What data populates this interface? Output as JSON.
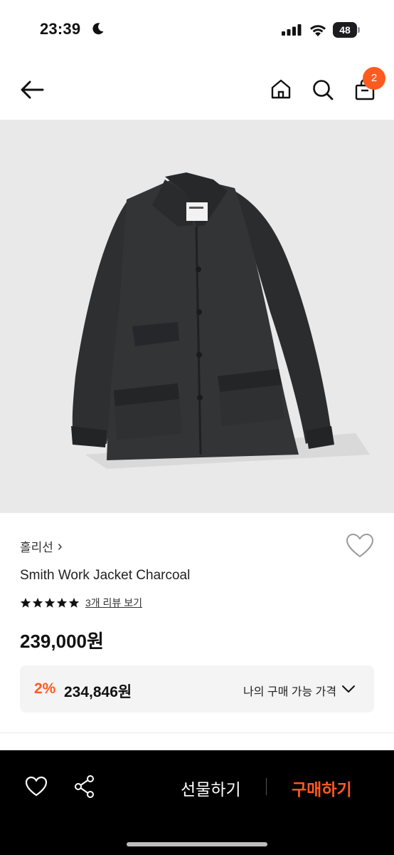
{
  "status_bar": {
    "time": "23:39",
    "battery_level": "48",
    "icons": [
      "moon-icon",
      "signal-icon",
      "wifi-icon",
      "battery-icon"
    ]
  },
  "nav": {
    "icons": [
      "back-arrow-icon",
      "home-icon",
      "search-icon",
      "cart-icon"
    ],
    "cart_count": "2"
  },
  "product": {
    "image": "charcoal-work-jacket-photo",
    "brand": "홀리선",
    "brand_chevron": "›",
    "name": "Smith Work Jacket Charcoal",
    "rating_stars": 5,
    "review_link": "3개 리뷰 보기",
    "price": "239,000원",
    "benefit": {
      "discount_rate": "2%",
      "discount_price": "234,846원",
      "label": "나의 구매 가능 가격"
    }
  },
  "bottom_bar": {
    "icons": [
      "heart-icon",
      "share-icon"
    ],
    "gift_label": "선물하기",
    "buy_label": "구매하기"
  },
  "colors": {
    "accent": "#ff5a1f",
    "bottom_bar_bg": "#000000",
    "image_bg": "#e9e9e9",
    "benefit_bg": "#f4f4f5"
  }
}
